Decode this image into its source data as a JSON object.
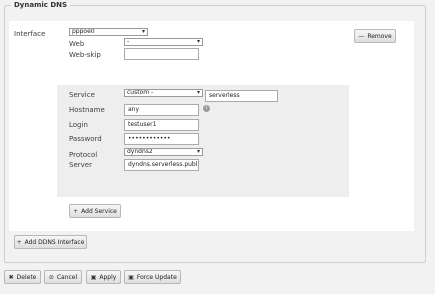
{
  "section": {
    "title": "Dynamic DNS"
  },
  "interface": {
    "label": "Interface",
    "value": "pppoe0",
    "remove_label": "Remove",
    "web_label": "Web",
    "web_value": "-",
    "webskip_label": "Web-skip",
    "webskip_value": ""
  },
  "service": {
    "service_label": "Service",
    "service_value": "custom -",
    "service_name": "serverless",
    "hostname_label": "Hostname",
    "hostname_value": "any",
    "login_label": "Login",
    "login_value": "testuser1",
    "password_label": "Password",
    "password_value": "••••••••••••",
    "protocol_label": "Protocol",
    "protocol_value": "dyndns2",
    "server_label": "Server",
    "server_value": "dyndns.serverless.public",
    "add_service_label": "Add Service"
  },
  "add_interface_label": "Add DDNS Interface",
  "footer": {
    "delete_label": "Delete",
    "cancel_label": "Cancel",
    "apply_label": "Apply",
    "force_update_label": "Force Update"
  },
  "icons": {
    "chevron": "▾",
    "remove": "—",
    "add": "+",
    "delete": "✖",
    "cancel": "⊘",
    "apply": "▣",
    "force": "▣",
    "info": "i"
  }
}
